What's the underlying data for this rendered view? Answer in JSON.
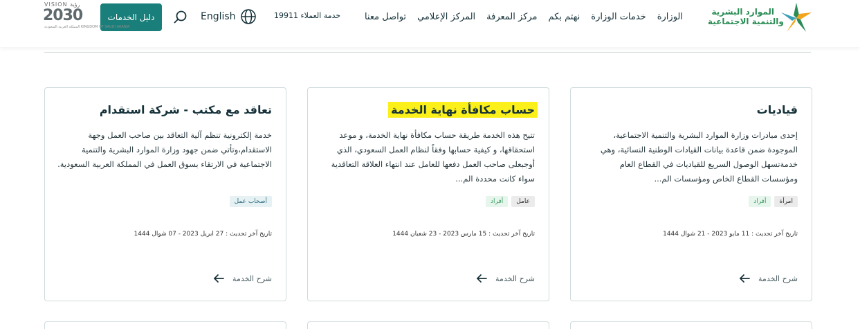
{
  "header": {
    "brand_line1": "الموارد البشرية",
    "brand_line2": "والتنمية الاجتماعية",
    "nav": [
      {
        "label": "الوزارة"
      },
      {
        "label": "خدمات الوزارة"
      },
      {
        "label": "نهتم بكم"
      },
      {
        "label": "مركز المعرفة"
      },
      {
        "label": "المركز الإعلامي"
      },
      {
        "label": "تواصل معنا"
      }
    ],
    "hotline": "خدمة العملاء 19911",
    "language": "English",
    "guide_button": "دليل الخدمات",
    "vision_top": "VISION رؤية",
    "vision_year": "2030",
    "vision_sub": "المملكة العربية السعودية KINGDOM OF SAUDI ARABIA"
  },
  "colors": {
    "accent": "#1a7f7a",
    "highlight": "#fbf01a",
    "brand_green": "#2a8c54"
  },
  "cards": [
    {
      "title": "قياديات",
      "description": "إحدى مبادرات وزارة الموارد البشرية والتنمية الاجتماعية، الموجودة ضمن قاعدة بيانات القيادات الوطنية النسائية، وهي خدمةتسهل الوصول السريع للقياديات في القطاع العام ومؤسسات القطاع الخاص ومؤسسات الم...",
      "tags": [
        {
          "label": "امرأة",
          "style": "gray"
        },
        {
          "label": "أفراد",
          "style": "green"
        }
      ],
      "date": "تاريخ آخر تحديث : 11 مايو 2023 - 21 شوال 1444",
      "link": "شرح الخدمة"
    },
    {
      "title": "حساب مكافأة نهاية الخدمة",
      "description": "تتيح هذه الخدمة طريقة حساب مكافأة نهاية الخدمة، و موعد استحقاقها، و كيفية حسابها وفقاً لنظام العمل السعودي، الذي أوجبعلى صاحب العمل دفعها للعامل عند انتهاء العلاقة التعاقدية سواء كانت محددة الم...",
      "tags": [
        {
          "label": "عامل",
          "style": "gray"
        },
        {
          "label": "أفراد",
          "style": "green"
        }
      ],
      "date": "تاريخ آخر تحديث : 15 مارس 2023 - 23 شعبان 1444",
      "link": "شرح الخدمة"
    },
    {
      "title": "تعاقد مع مكتب - شركة استقدام",
      "description": "خدمة إلكترونية تنظم آلية التعاقد بين صاحب العمل وجهة الاستقدام،وتأتي ضمن جهود وزارة الموارد البشرية والتنمية الاجتماعية في الارتقاء بسوق العمل في المملكة العربية السعودية.",
      "tags": [
        {
          "label": "أصحاب عمل",
          "style": "blue"
        }
      ],
      "date": "تاريخ آخر تحديث : 27 ابريل 2023 - 07 شوال 1444",
      "link": "شرح الخدمة"
    }
  ]
}
